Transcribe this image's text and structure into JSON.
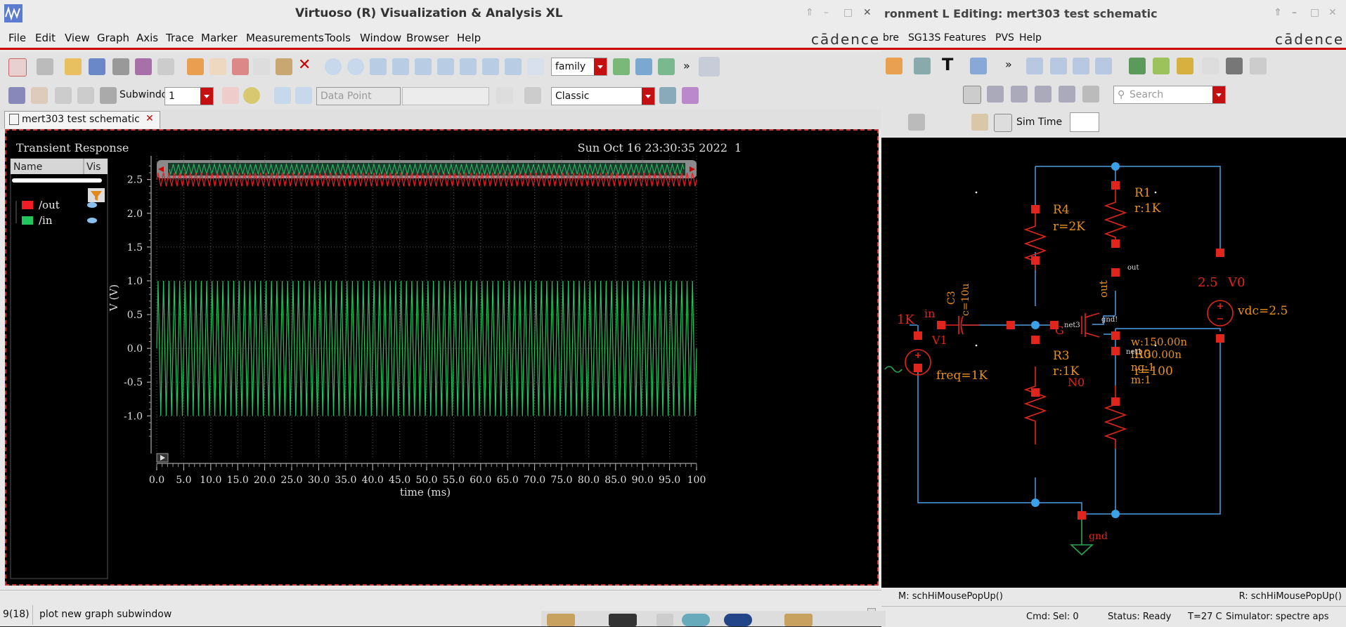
{
  "viva": {
    "title": "Virtuoso (R) Visualization & Analysis XL",
    "menu": [
      "File",
      "Edit",
      "View",
      "Graph",
      "Axis",
      "Trace",
      "Marker",
      "Measurements",
      "Tools",
      "Window",
      "Browser",
      "Help"
    ],
    "brand": "cādence",
    "toolbar": {
      "family_select": "family",
      "subwindow_label": "Subwindow:",
      "subwindow_value": "1",
      "data_point_select": "Data Point",
      "style_select": "Classic"
    },
    "tab_label": "mert303 test schematic",
    "plot": {
      "title": "Transient Response",
      "timestamp": "Sun Oct 16 23:30:35 2022",
      "page_num": "1",
      "list_header": {
        "name": "Name",
        "vis": "Vis"
      },
      "traces": [
        {
          "name": "/out",
          "color": "#ee1c25"
        },
        {
          "name": "/in",
          "color": "#22c55e"
        }
      ]
    },
    "status": {
      "count": "9(18)",
      "message": "plot new graph subwindow"
    }
  },
  "chart_data": {
    "type": "line",
    "title": "Transient Response",
    "xlabel": "time (ms)",
    "ylabel": "V (V)",
    "xlim": [
      0,
      100
    ],
    "ylim": [
      -1.35,
      2.85
    ],
    "x_ticks": [
      "0.0",
      "5.0",
      "10.0",
      "15.0",
      "20.0",
      "25.0",
      "30.0",
      "35.0",
      "40.0",
      "45.0",
      "50.0",
      "55.0",
      "60.0",
      "65.0",
      "70.0",
      "75.0",
      "80.0",
      "85.0",
      "90.0",
      "95.0",
      "100"
    ],
    "y_ticks": [
      "2.5",
      "2.0",
      "1.5",
      "1.0",
      "0.5",
      "0.0",
      "-0.5",
      "-1.0"
    ],
    "y_tick_values": [
      2.5,
      2.0,
      1.5,
      1.0,
      0.5,
      0.0,
      -0.5,
      -1.0
    ],
    "grid": true,
    "series": [
      {
        "name": "/out",
        "color": "#ee1c25",
        "frequency_khz": 1,
        "dc_offset": 2.5,
        "amplitude": 0.1
      },
      {
        "name": "/in",
        "color": "#22c55e",
        "frequency_khz": 1,
        "dc_offset": 0.0,
        "amplitude": 1.0
      }
    ]
  },
  "schematic": {
    "title": "ronment L Editing: mert303 test schematic",
    "menu": [
      "bre",
      "SG13S Features",
      "PVS",
      "Help"
    ],
    "brand": "cādence",
    "search_placeholder": "Search",
    "sim_time_label": "Sim Time",
    "labels": {
      "R4": "R4",
      "R4_val": "r=2K",
      "R1": "R1",
      "R1_val": "r:1K",
      "R3": "R3",
      "R3_val": "r:1K",
      "R0": "R0",
      "R0_val": "r=100",
      "C3": "C3",
      "C3_val": "c=10u",
      "V1": "V1",
      "V1_freq": "freq=1K",
      "V1_amp": "1K",
      "V0": "V0",
      "V0_val": "vdc=2.5",
      "V0_amp": "2.5",
      "N0": "N0",
      "in": "in",
      "out": "out",
      "gnd": "gnd",
      "net3": "net3",
      "net1": "net1",
      "gnd_pin": "gnd!",
      "out_pin": "out",
      "G": "G",
      "m_w": "w:150.00n",
      "m_l": "l:130.00n",
      "m_ng": "ng:1",
      "m_m": "m:1"
    },
    "status_left": "M: schHiMousePopUp()",
    "status_right": "R: schHiMousePopUp()",
    "status_bar": {
      "cmd": "Cmd:",
      "sel": "Sel: 0",
      "status": "Status: Ready",
      "temp": "T=27 C",
      "simulator": "Simulator: spectre aps"
    }
  }
}
